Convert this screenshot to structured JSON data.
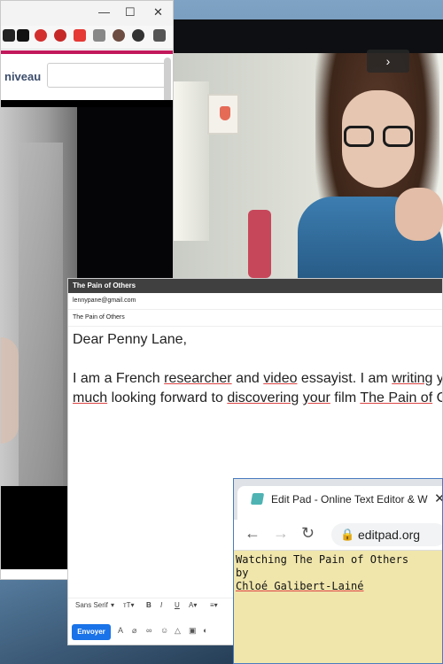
{
  "browser": {
    "win_minimize": "—",
    "win_maximize": "☐",
    "win_close": "✕",
    "field_label": "niveau",
    "field_value": ""
  },
  "webcam": {
    "next_icon": "›"
  },
  "email": {
    "title": "The Pain of Others",
    "to": "lennypane@gmail.com",
    "subject": "The Pain of Others",
    "greeting": "Dear Penny Lane,",
    "body_line1_a": "I am a French ",
    "body_line1_b": "researcher",
    "body_line1_c": " and ",
    "body_line1_d": "video",
    "body_line1_e": " essayist. I am ",
    "body_line1_f": "writing",
    "body_line1_g": " y",
    "body_line2_a": "much",
    "body_line2_b": " looking forward to ",
    "body_line2_c": "discovering",
    "body_line2_d": " ",
    "body_line2_e": "your",
    "body_line2_f": " film ",
    "body_line2_g": "The Pain of",
    "body_line2_h": " C",
    "font_select": "Sans Serif",
    "send_label": "Envoyer"
  },
  "editpad": {
    "tab_title": "Edit Pad - Online Text Editor & W",
    "url": "editpad.org",
    "line1": "Watching The Pain of Others",
    "line2": "by",
    "line3": "Chloé Galibert-Lainé"
  },
  "colors": {
    "accent_pink": "#c2185b",
    "send_blue": "#1a73e8",
    "editpad_bg": "#f0e6ac"
  }
}
